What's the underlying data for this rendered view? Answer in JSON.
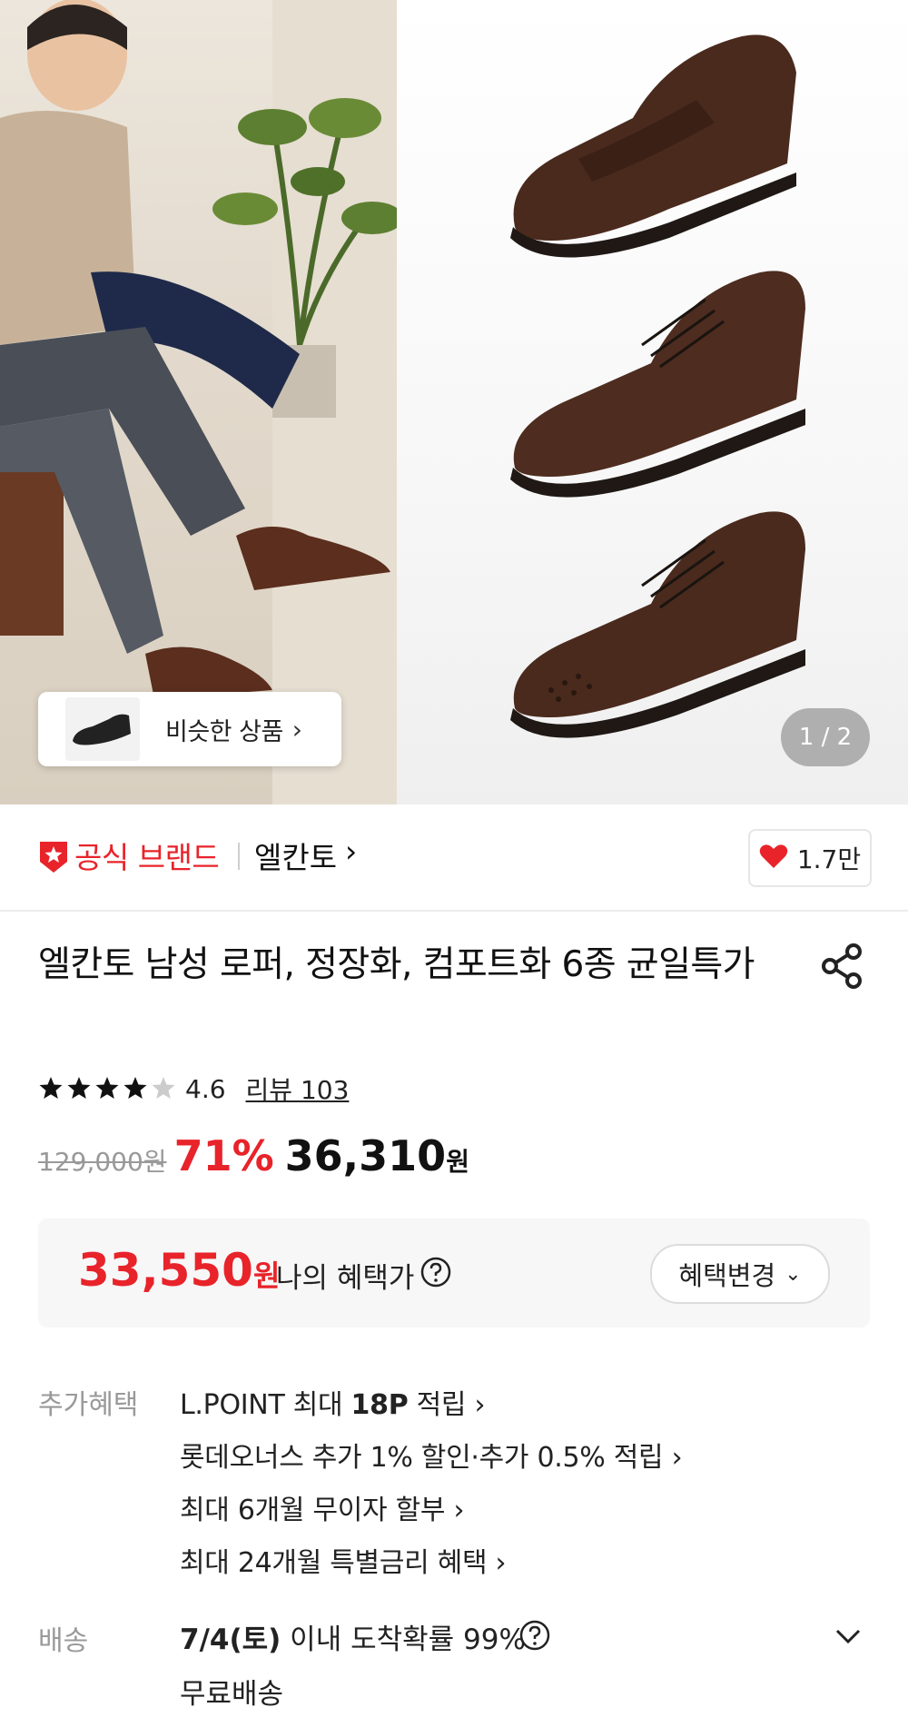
{
  "gallery": {
    "similar_label": "비슷한 상품",
    "counter": "1 / 2"
  },
  "brand": {
    "official_label": "공식 브랜드",
    "name": "엘칸토",
    "likes": "1.7만"
  },
  "product": {
    "title": "엘칸토 남성 로퍼, 정장화, 컴포트화 6종 균일특가",
    "rating": "4.6",
    "rating_value": 4.6,
    "review_label": "리뷰 103",
    "original_price": "129,000원",
    "discount": "71%",
    "price": "36,310",
    "price_unit": "원"
  },
  "benefit": {
    "my_price": "33,550",
    "my_price_unit": "원",
    "my_price_label": "나의 혜택가",
    "change_button": "혜택변경"
  },
  "extra": {
    "label": "추가혜택",
    "lpoint_prefix": "L.POINT 최대 ",
    "lpoint_bold": "18P",
    "lpoint_suffix": " 적립",
    "lotte_card": "롯데오너스 추가 1% 할인·추가 0.5% 적립",
    "installment": "최대 6개월 무이자 할부",
    "special_rate": "최대 24개월 특별금리 혜택"
  },
  "shipping": {
    "label": "배송",
    "date_bold": "7/4(토)",
    "date_rest": " 이내 도착확률 99%",
    "free": "무료배송"
  },
  "colors": {
    "accent_red": "#e8232a",
    "muted_gray": "#999999"
  }
}
